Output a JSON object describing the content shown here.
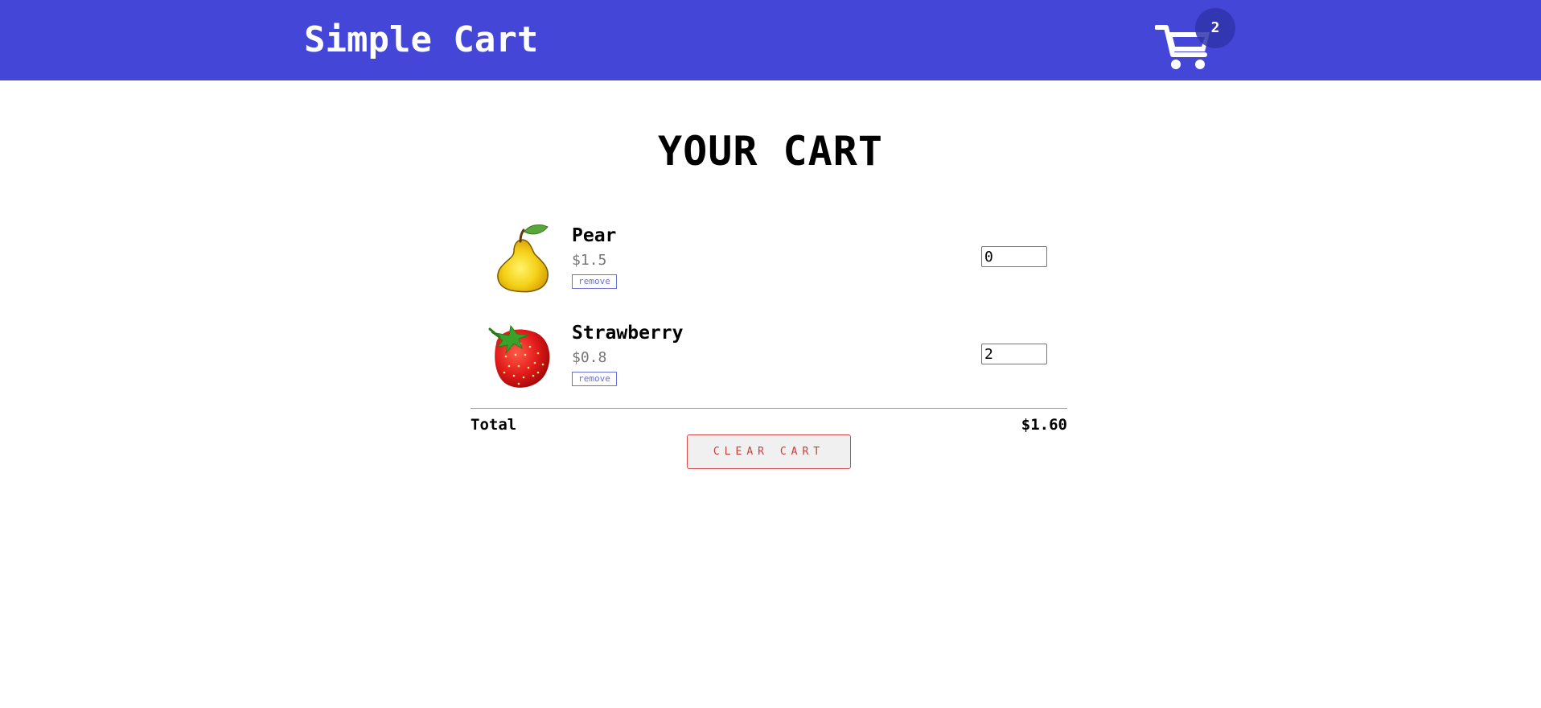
{
  "header": {
    "brand": "Simple Cart",
    "cart_count": "2",
    "cart_icon": "shopping-cart-icon",
    "color": "#4446d8"
  },
  "page": {
    "title": "YOUR CART"
  },
  "items": [
    {
      "name": "Pear",
      "price": "$1.5",
      "remove_label": "remove",
      "quantity": "0",
      "image_icon": "pear-icon"
    },
    {
      "name": "Strawberry",
      "price": "$0.8",
      "remove_label": "remove",
      "quantity": "2",
      "image_icon": "strawberry-icon"
    }
  ],
  "summary": {
    "total_label": "Total",
    "total_value": "$1.60",
    "clear_label": "CLEAR CART"
  }
}
